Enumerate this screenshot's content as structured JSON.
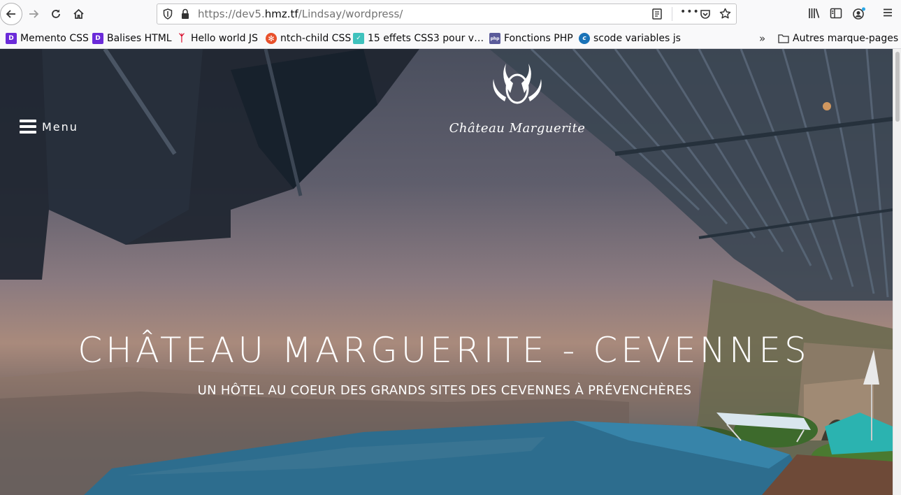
{
  "browser": {
    "url_prefix": "https://dev5.",
    "url_domain": "hmz.tf",
    "url_path": "/Lindsay/wordpress/",
    "more_label": "•••"
  },
  "bookmarks": {
    "items": [
      {
        "label": "Memento CSS",
        "color": "#6b2bd9",
        "glyph": "D"
      },
      {
        "label": "Balises HTML",
        "color": "#6b2bd9",
        "glyph": "D"
      },
      {
        "label": "Hello world JS",
        "color": "#d70022",
        "glyph": "ᛉ"
      },
      {
        "label": "ntch-child CSS",
        "color": "#e8502b",
        "glyph": "✻"
      },
      {
        "label": "15 effets CSS3 pour v…",
        "color": "#3fc2bd",
        "glyph": "✓"
      },
      {
        "label": "Fonctions PHP",
        "color": "#5b5b9a",
        "glyph": "php"
      },
      {
        "label": "scode variables js",
        "color": "#1a73b8",
        "glyph": "c"
      }
    ],
    "overflow_label": "»",
    "folder_label": "Autres marque-pages"
  },
  "site": {
    "menu_label": "Menu",
    "logo_name": "Château   Marguerite",
    "hero_title": "CHÂTEAU MARGUERITE - CEVENNES",
    "hero_subtitle": "UN HÔTEL AU COEUR DES GRANDS SITES DES CEVENNES À PRÉVENCHÈRES"
  }
}
